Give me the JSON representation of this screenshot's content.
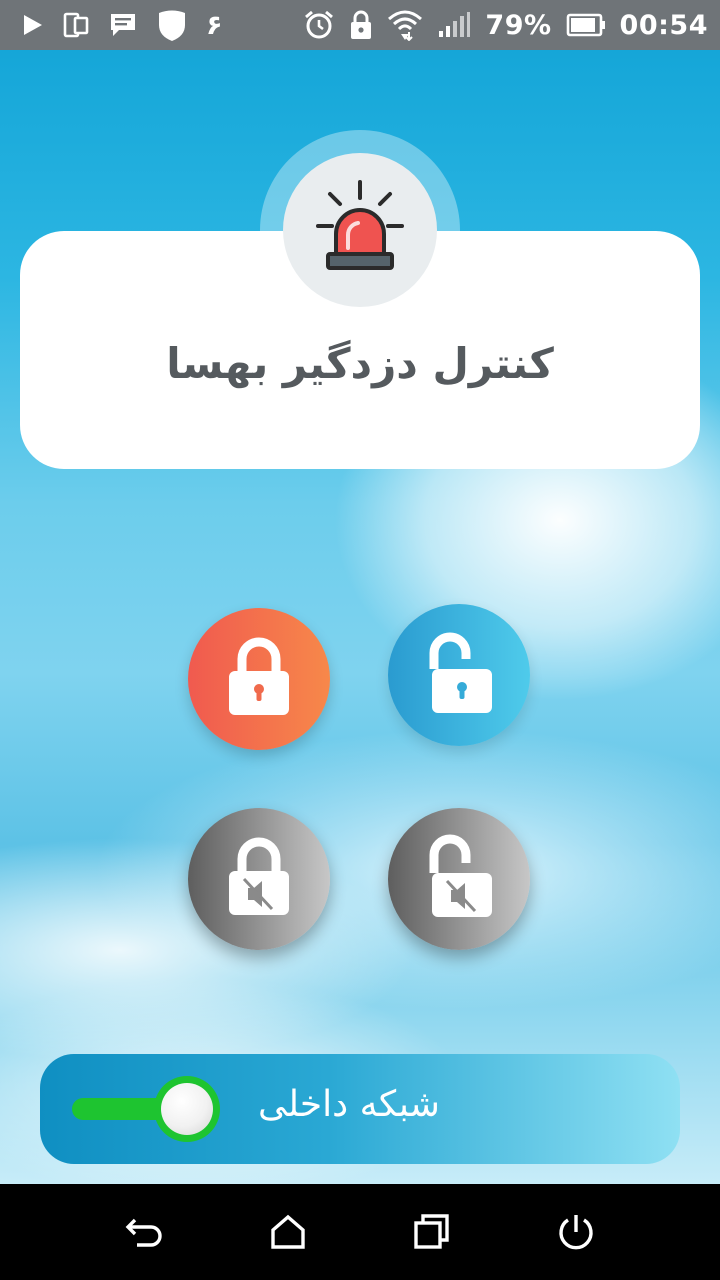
{
  "status_bar": {
    "time": "00:54",
    "battery_percent": "79%",
    "left_icons": [
      "play-store-icon",
      "phone-screen-icon",
      "message-icon",
      "shield-icon",
      "persian-six-icon"
    ],
    "right_icons": [
      "alarm-icon",
      "lock-icon",
      "wifi-icon",
      "signal-icon",
      "battery-icon"
    ],
    "persian_digit": "۶",
    "battery_level": 0.79
  },
  "header": {
    "title": "کنترل دزدگیر بهسا",
    "icon": "siren-icon"
  },
  "controls": {
    "lock": {
      "icon": "lock-icon",
      "color": "#f05a4f"
    },
    "unlock": {
      "icon": "unlock-icon",
      "color": "#2a9bd0"
    },
    "silent_lock": {
      "icon": "lock-mute-icon",
      "color": "#5e5e5e"
    },
    "silent_unlock": {
      "icon": "unlock-mute-icon",
      "color": "#5e5e5e"
    }
  },
  "network": {
    "label": "شبکه داخلی",
    "toggle_on": true,
    "toggle_color": "#1ec430"
  },
  "nav_bar": {
    "icons": [
      "back-icon",
      "home-icon",
      "recent-apps-icon",
      "power-icon"
    ]
  }
}
